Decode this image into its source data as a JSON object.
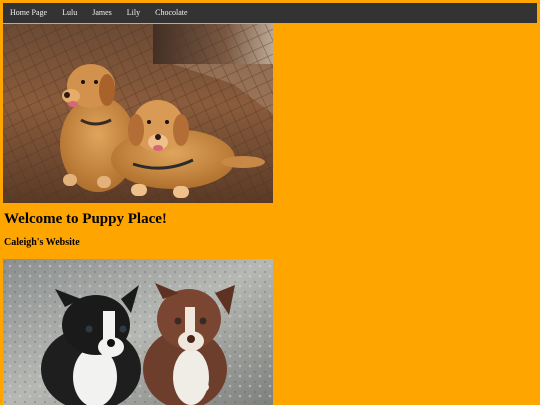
{
  "nav": {
    "items": [
      {
        "label": "Home Page"
      },
      {
        "label": "Lulu"
      },
      {
        "label": "James"
      },
      {
        "label": "Lily"
      },
      {
        "label": "Chocolate"
      }
    ]
  },
  "main": {
    "heading": "Welcome to Puppy Place!",
    "subheading": "Caleigh's Website"
  },
  "colors": {
    "page_background": "#FFA500",
    "nav_background": "#333333",
    "nav_text": "#f2f2f2"
  },
  "images": {
    "top": "two-golden-retrievers-on-wood-floor",
    "bottom": "two-border-collie-puppies"
  }
}
